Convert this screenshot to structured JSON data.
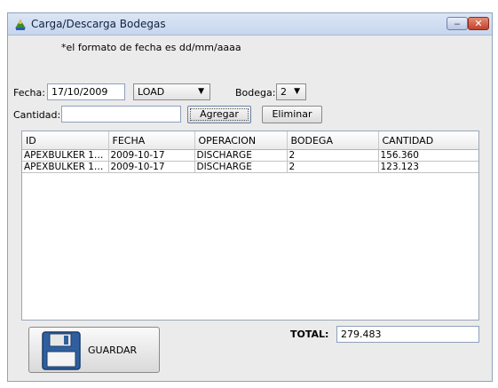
{
  "window": {
    "title": "Carga/Descarga Bodegas",
    "minimize_glyph": "‒",
    "close_glyph": "✕",
    "icon": "app-icon"
  },
  "note": "*el formato de fecha es dd/mm/aaaa",
  "form": {
    "fecha_label": "Fecha:",
    "fecha_value": "17/10/2009",
    "operation_selected": "LOAD",
    "bodega_label": "Bodega:",
    "bodega_selected": "2",
    "cantidad_label": "Cantidad:",
    "cantidad_value": "",
    "add_button": "Agregar",
    "delete_button": "Eliminar"
  },
  "table": {
    "columns": [
      "ID",
      "FECHA",
      "OPERACION",
      "BODEGA",
      "CANTIDAD"
    ],
    "rows": [
      [
        "APEXBULKER 12...",
        "2009-10-17",
        "DISCHARGE",
        "2",
        "156.360"
      ],
      [
        "APEXBULKER 12...",
        "2009-10-17",
        "DISCHARGE",
        "2",
        "123.123"
      ]
    ]
  },
  "footer": {
    "save_button": "GUARDAR",
    "save_icon": "floppy-disk-icon",
    "total_label": "TOTAL:",
    "total_value": "279.483"
  },
  "colors": {
    "titlebar": "#c7d6ee",
    "window_bg": "#ebebeb",
    "close": "#c0412b"
  }
}
